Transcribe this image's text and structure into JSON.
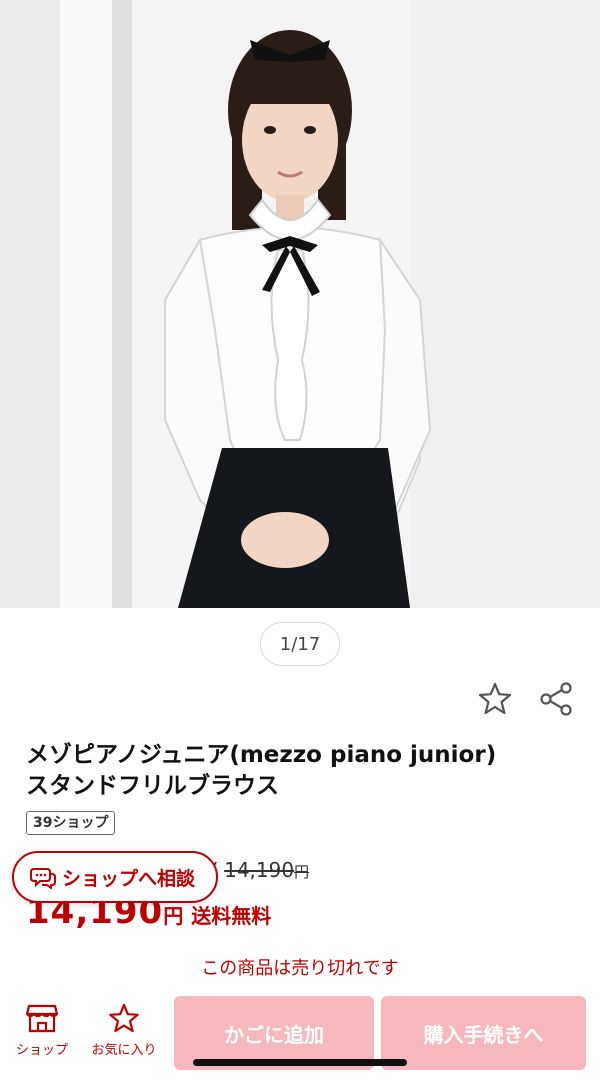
{
  "gallery": {
    "counter": "1/17"
  },
  "product": {
    "title_line1": "メゾピアノジュニア(mezzo piano junior)",
    "title_line2": "スタンドフリルブラウス",
    "badge": "39ショップ",
    "old_price_prefix": "¥",
    "old_price": "14,190",
    "old_price_unit": "円",
    "price": "14,190",
    "price_unit": "円",
    "shipping": "送料無料",
    "status": "この商品は売り切れです"
  },
  "floating": {
    "consult_label": "ショップへ相談"
  },
  "bottom_bar": {
    "shop_label": "ショップ",
    "favorite_label": "お気に入り",
    "cart_label": "かごに追加",
    "checkout_label": "購入手続きへ"
  },
  "colors": {
    "accent": "#bf0000",
    "cta_disabled": "#f6b8be"
  },
  "icons": [
    "star-outline-icon",
    "share-icon",
    "chat-bubble-icon",
    "shop-icon",
    "star-icon"
  ]
}
